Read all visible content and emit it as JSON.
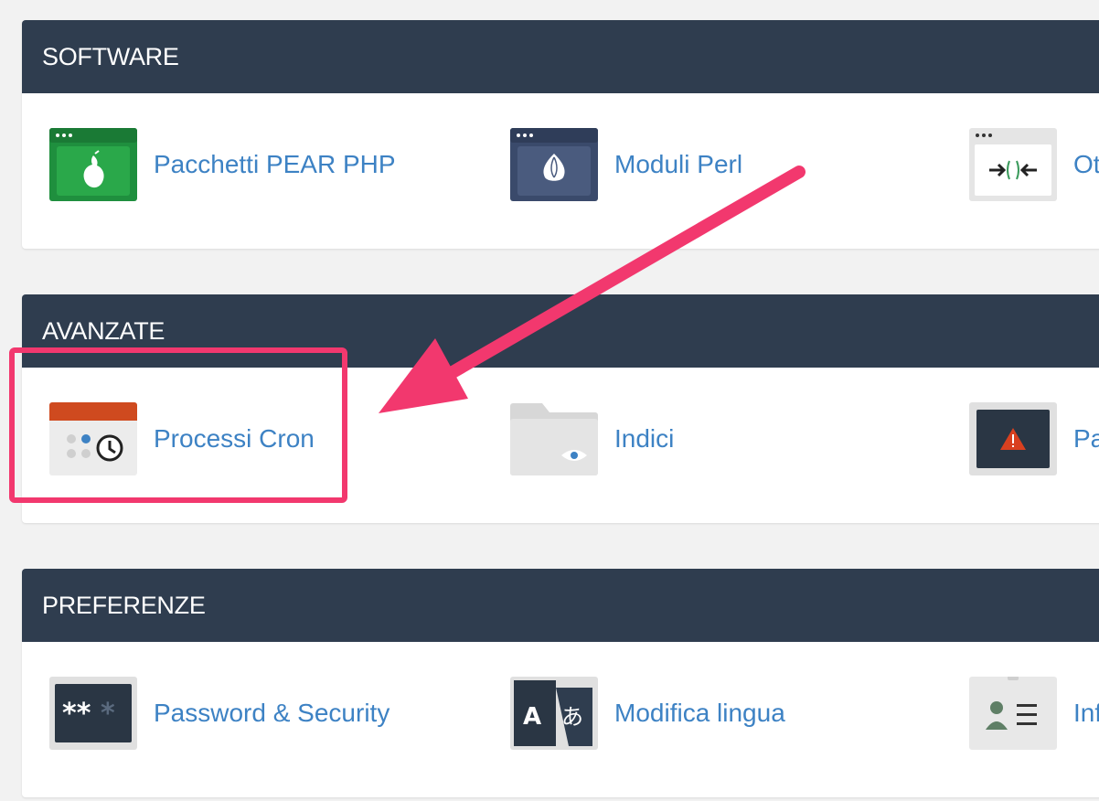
{
  "sections": [
    {
      "title": "SOFTWARE",
      "items": [
        {
          "label": "Pacchetti PEAR PHP",
          "icon": "pear-icon"
        },
        {
          "label": "Moduli Perl",
          "icon": "perl-onion-icon"
        },
        {
          "label": "Ot",
          "icon": "optimize-arrows-icon"
        }
      ]
    },
    {
      "title": "AVANZATE",
      "items": [
        {
          "label": "Processi Cron",
          "icon": "cron-calendar-icon"
        },
        {
          "label": "Indici",
          "icon": "folder-eye-icon"
        },
        {
          "label": "Pa",
          "icon": "warning-page-icon"
        }
      ]
    },
    {
      "title": "PREFERENZE",
      "items": [
        {
          "label": "Password & Security",
          "icon": "password-icon"
        },
        {
          "label": "Modifica lingua",
          "icon": "language-icon"
        },
        {
          "label": "Inf",
          "icon": "contact-info-icon"
        }
      ]
    }
  ],
  "colors": {
    "header_bg": "#2f3d4f",
    "link": "#3d82c4",
    "annotation": "#f2386e"
  }
}
